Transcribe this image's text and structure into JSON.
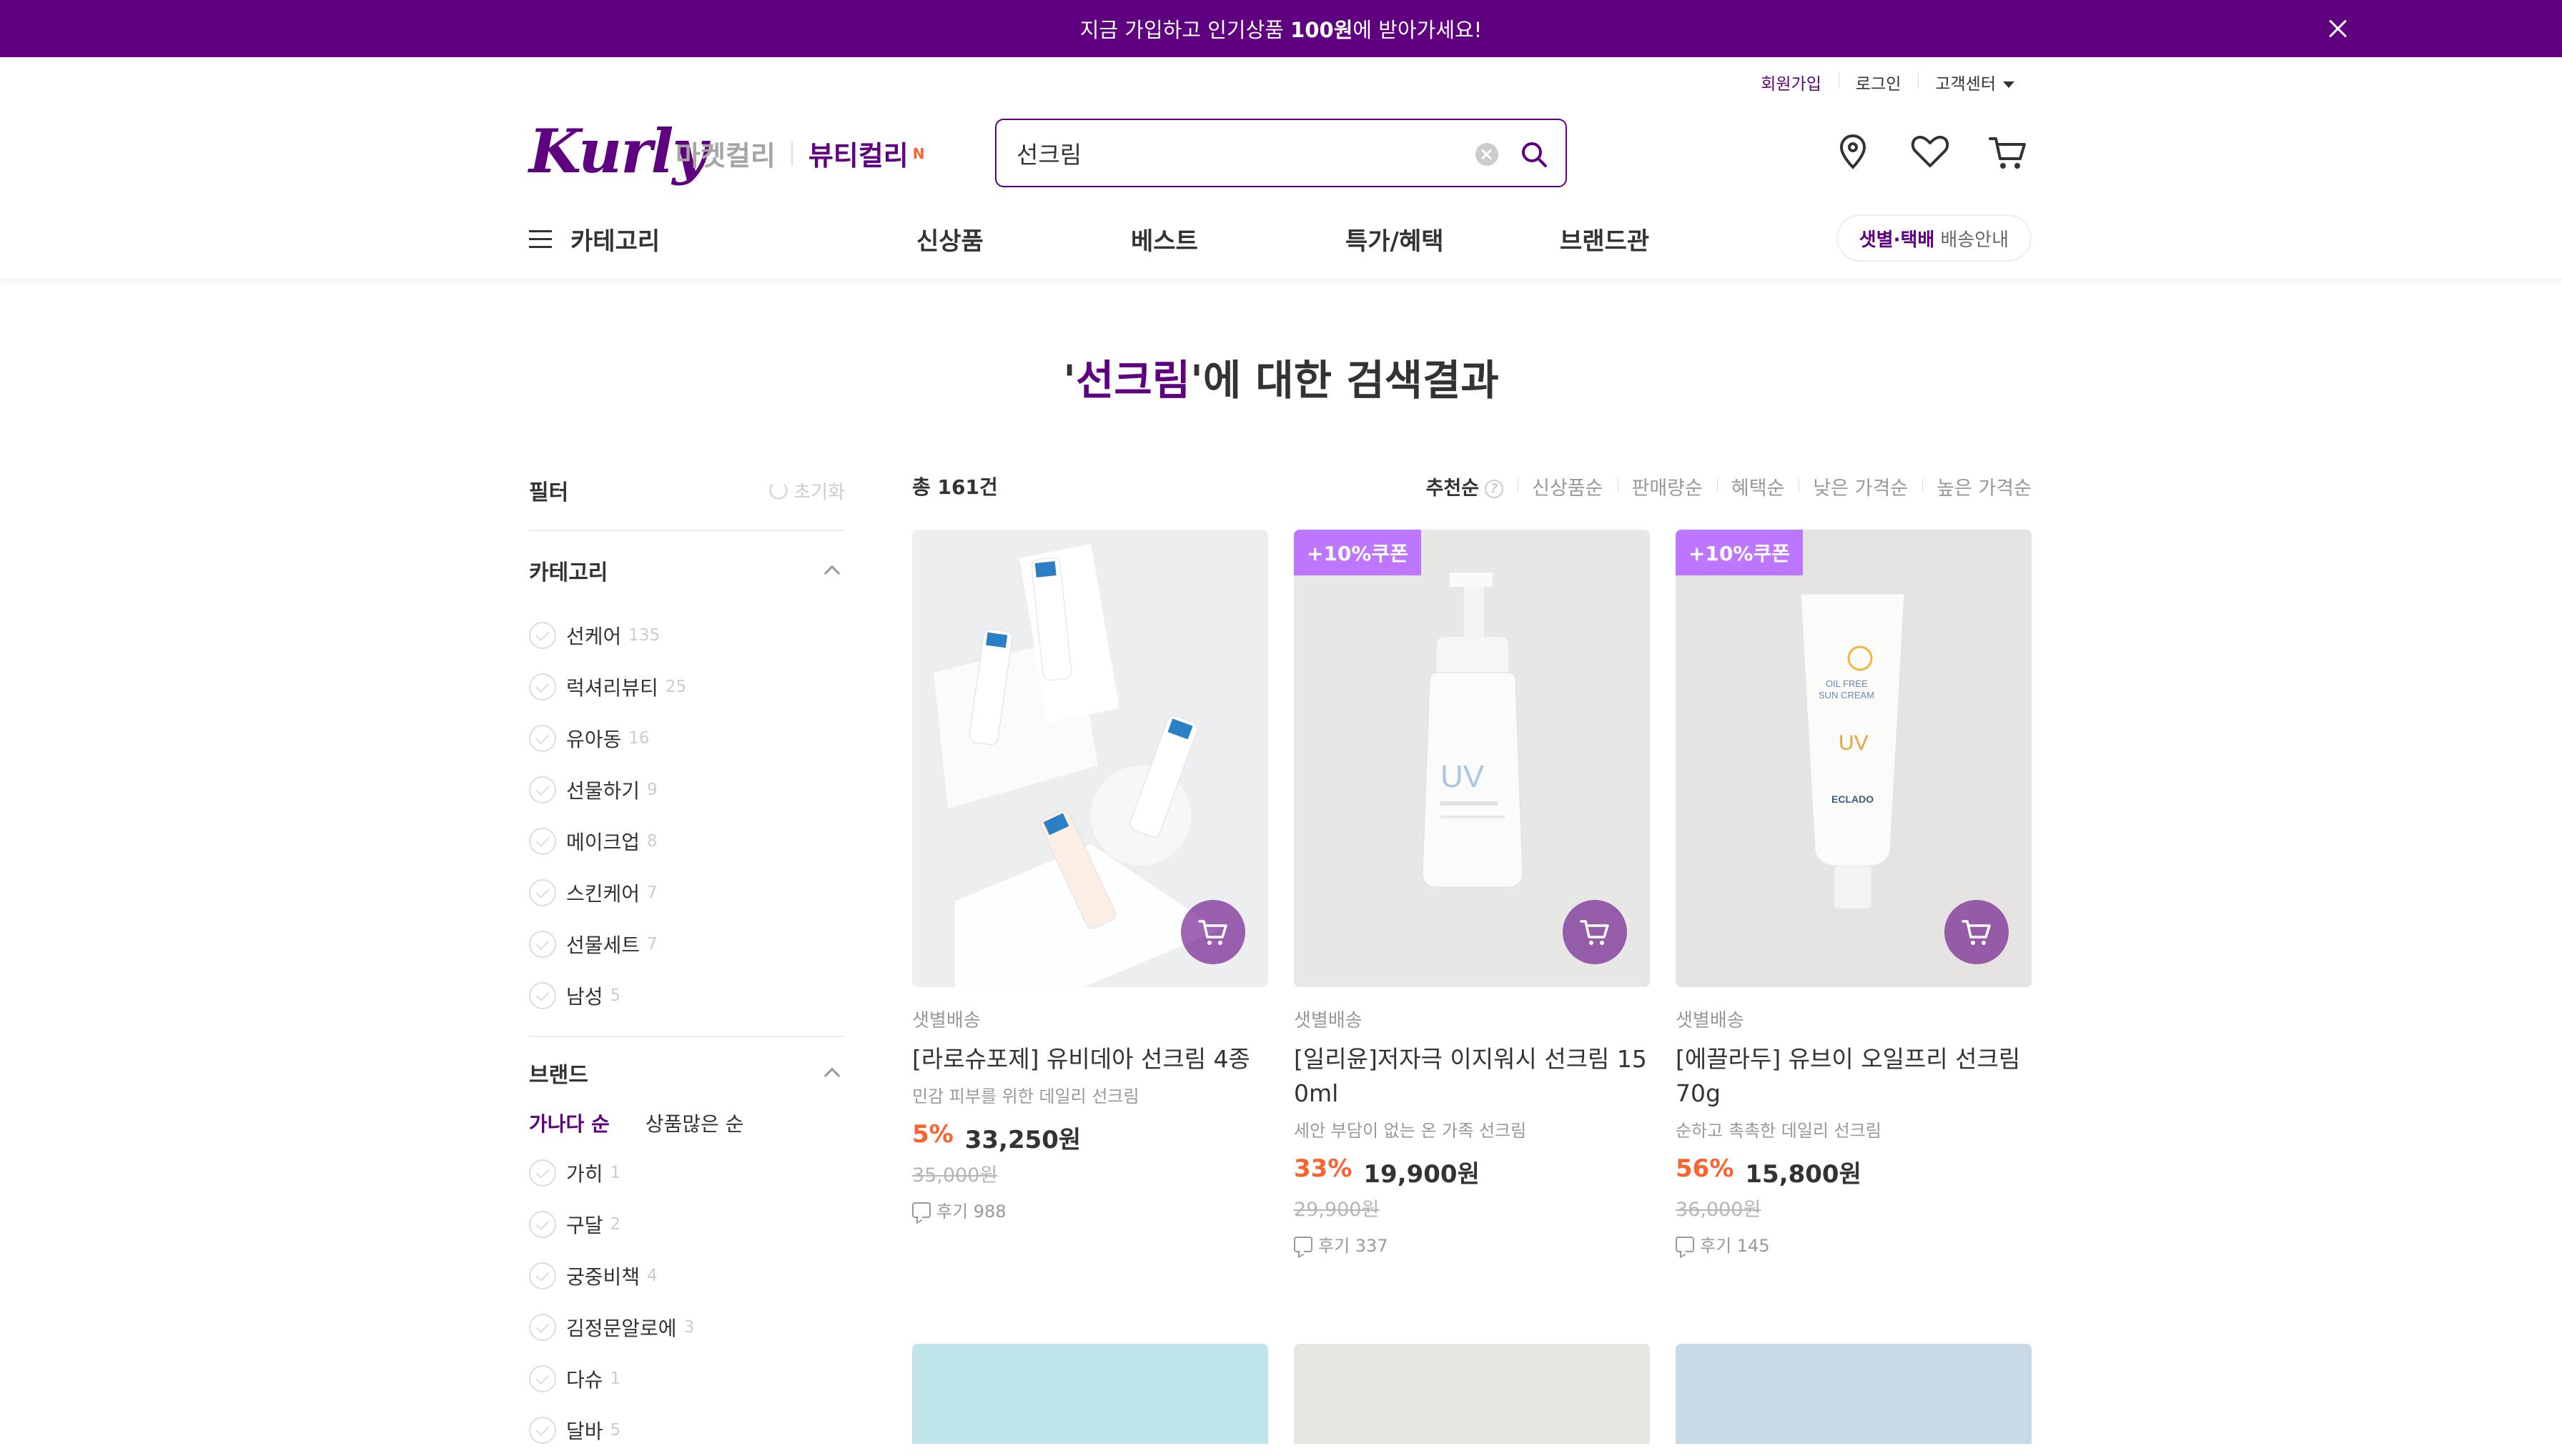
{
  "promo": {
    "text_pre": "지금 가입하고 인기상품 ",
    "text_bold": "100원",
    "text_post": "에 받아가세요!"
  },
  "util": {
    "signup": "회원가입",
    "login": "로그인",
    "support": "고객센터"
  },
  "brand": {
    "logo": "Kurly",
    "market_tab": "마켓컬리",
    "beauty_tab": "뷰티컬리",
    "new_badge": "N"
  },
  "search": {
    "value": "선크림"
  },
  "gnb": {
    "category": "카테고리",
    "menu": [
      "신상품",
      "베스트",
      "특가/혜택",
      "브랜드관"
    ],
    "delivery_bold": "샛별·택배",
    "delivery_text": "배송안내"
  },
  "result_title": {
    "quote_open": "'",
    "keyword": "선크림",
    "rest": "'에 대한 검색결과"
  },
  "filter": {
    "title": "필터",
    "reset": "초기화",
    "category_title": "카테고리",
    "categories": [
      {
        "label": "선케어",
        "count": "135"
      },
      {
        "label": "럭셔리뷰티",
        "count": "25"
      },
      {
        "label": "유아동",
        "count": "16"
      },
      {
        "label": "선물하기",
        "count": "9"
      },
      {
        "label": "메이크업",
        "count": "8"
      },
      {
        "label": "스킨케어",
        "count": "7"
      },
      {
        "label": "선물세트",
        "count": "7"
      },
      {
        "label": "남성",
        "count": "5"
      }
    ],
    "brand_title": "브랜드",
    "brand_sort": [
      "가나다 순",
      "상품많은 순"
    ],
    "brands": [
      {
        "label": "가히",
        "count": "1"
      },
      {
        "label": "구달",
        "count": "2"
      },
      {
        "label": "궁중비책",
        "count": "4"
      },
      {
        "label": "김정문알로에",
        "count": "3"
      },
      {
        "label": "다슈",
        "count": "1"
      },
      {
        "label": "달바",
        "count": "5"
      }
    ]
  },
  "listing": {
    "total": "총 161건",
    "sorts": [
      "추천순",
      "신상품순",
      "판매량순",
      "혜택순",
      "낮은 가격순",
      "높은 가격순"
    ]
  },
  "products": [
    {
      "badge": "",
      "delivery": "샛별배송",
      "name": "[라로슈포제] 유비데아 선크림 4종",
      "desc": "민감 피부를 위한 데일리 선크림",
      "discount": "5%",
      "price": "33,250원",
      "original": "35,000원",
      "review": "후기 988"
    },
    {
      "badge": "+10%쿠폰",
      "delivery": "샛별배송",
      "name": "[일리윤]저자극 이지워시 선크림 150ml",
      "desc": "세안 부담이 없는 온 가족 선크림",
      "discount": "33%",
      "price": "19,900원",
      "original": "29,900원",
      "review": "후기 337"
    },
    {
      "badge": "+10%쿠폰",
      "delivery": "샛별배송",
      "name": "[에끌라두] 유브이 오일프리 선크림 70g",
      "desc": "순하고 촉촉한 데일리 선크림",
      "discount": "56%",
      "price": "15,800원",
      "original": "36,000원",
      "review": "후기 145"
    }
  ],
  "colors": {
    "brand": "#5f0080",
    "discount": "#fa622f",
    "coupon": "#bd76ff"
  }
}
